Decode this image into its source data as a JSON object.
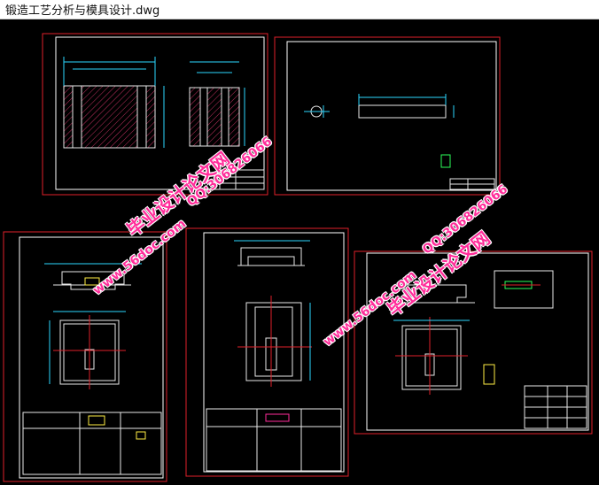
{
  "window": {
    "title": "锻造工艺分析与模具设计.dwg"
  },
  "colors": {
    "canvas": "#000000",
    "sheet_border": "#e0202a",
    "frame": "#ffffff",
    "drawing": "#e8e8e8",
    "dimension": "#2bd7ff",
    "hatch": "#c03060",
    "note": "#2cff5a",
    "title_text": "#ffee44",
    "watermark": "#ff2d9a"
  },
  "watermarks": [
    {
      "text": "毕业设计论文网"
    },
    {
      "text": "www.56doc.com"
    },
    {
      "text": "QQ:306826066"
    },
    {
      "text": "毕业设计论文网"
    },
    {
      "text": "www.56doc.com"
    },
    {
      "text": "QQ:306826066"
    }
  ]
}
